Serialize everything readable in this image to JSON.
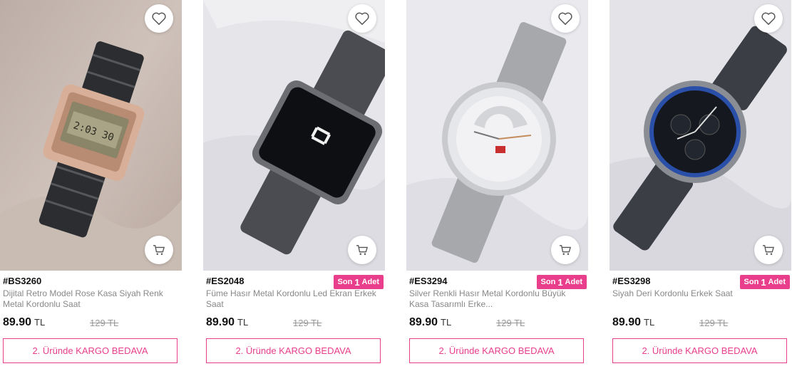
{
  "accent_color": "#e83e8c",
  "products": [
    {
      "code": "#BS3260",
      "title": "Dijital Retro Model Rose Kasa Siyah Renk Metal Kordonlu Saat",
      "price": "89.90",
      "currency": "TL",
      "old_price": "129 TL",
      "stock_badge": null,
      "cargo_label": "2. Üründe KARGO BEDAVA",
      "image": "digital-retro-watch"
    },
    {
      "code": "#ES2048",
      "title": "Füme Hasır Metal Kordonlu Led Ekran Erkek Saat",
      "price": "89.90",
      "currency": "TL",
      "old_price": "129 TL",
      "stock_badge": {
        "prefix": "Son",
        "count": "1",
        "suffix": "Adet"
      },
      "cargo_label": "2. Üründe KARGO BEDAVA",
      "image": "led-square-watch"
    },
    {
      "code": "#ES3294",
      "title": "Silver Renkli Hasır Metal Kordonlu Büyük Kasa Tasarımlı Erke...",
      "price": "89.90",
      "currency": "TL",
      "old_price": "129 TL",
      "stock_badge": {
        "prefix": "Son",
        "count": "1",
        "suffix": "Adet"
      },
      "cargo_label": "2. Üründe KARGO BEDAVA",
      "image": "silver-mesh-watch"
    },
    {
      "code": "#ES3298",
      "title": "Siyah Deri Kordonlu Erkek Saat",
      "price": "89.90",
      "currency": "TL",
      "old_price": "129 TL",
      "stock_badge": {
        "prefix": "Son",
        "count": "1",
        "suffix": "Adet"
      },
      "cargo_label": "2. Üründe KARGO BEDAVA",
      "image": "black-chronograph-watch"
    }
  ],
  "icons": {
    "favorite": "heart-icon",
    "cart": "cart-icon"
  }
}
